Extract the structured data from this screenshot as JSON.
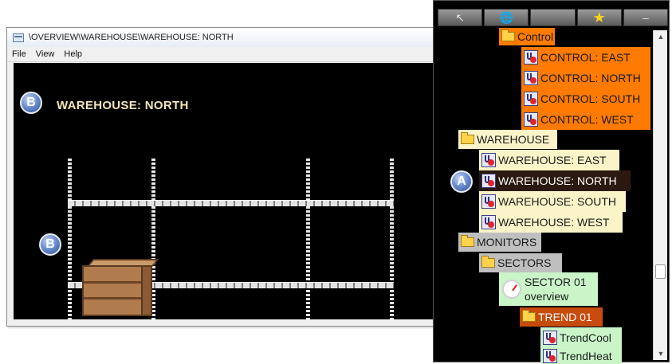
{
  "window": {
    "title": "\\OVERVIEW\\WAREHOUSE\\WAREHOUSE: NORTH",
    "menu": [
      "File",
      "View",
      "Help"
    ]
  },
  "canvas": {
    "heading": "WAREHOUSE: NORTH",
    "callout_b": "B"
  },
  "callout_a": "A",
  "tree": {
    "items": [
      {
        "label": "Control",
        "style": "orange",
        "icon": "folder-icon"
      },
      {
        "label": "CONTROL: EAST",
        "style": "orange",
        "icon": "flask-icon"
      },
      {
        "label": "CONTROL: NORTH",
        "style": "orange",
        "icon": "flask-icon"
      },
      {
        "label": "CONTROL: SOUTH",
        "style": "orange",
        "icon": "flask-icon"
      },
      {
        "label": "CONTROL: WEST",
        "style": "orange",
        "icon": "flask-icon"
      },
      {
        "label": "WAREHOUSE",
        "style": "cream",
        "icon": "folder-icon"
      },
      {
        "label": "WAREHOUSE: EAST",
        "style": "cream",
        "icon": "flask-icon"
      },
      {
        "label": "WAREHOUSE: NORTH",
        "style": "selected",
        "icon": "flask-icon"
      },
      {
        "label": "WAREHOUSE: SOUTH",
        "style": "cream",
        "icon": "flask-icon"
      },
      {
        "label": "WAREHOUSE: WEST",
        "style": "cream",
        "icon": "flask-icon"
      },
      {
        "label": "MONITORS",
        "style": "grey",
        "icon": "folder-icon"
      },
      {
        "label": "SECTORS",
        "style": "grey",
        "icon": "folder-icon"
      },
      {
        "label": "SECTOR 01",
        "label2": "overview",
        "style": "green",
        "icon": "gauge-icon"
      },
      {
        "label": "TREND 01",
        "style": "red",
        "icon": "folder-icon"
      },
      {
        "label": "TrendCool",
        "style": "green",
        "icon": "flask-icon"
      },
      {
        "label": "TrendHeat",
        "style": "green",
        "icon": "flask-icon"
      }
    ]
  },
  "colors": {
    "orange": "#ff7b00",
    "cream": "#fbf4c8",
    "selected": "#2b190f",
    "grey": "#bfbfbf",
    "green": "#c9f5c9",
    "red": "#c64b0c"
  }
}
